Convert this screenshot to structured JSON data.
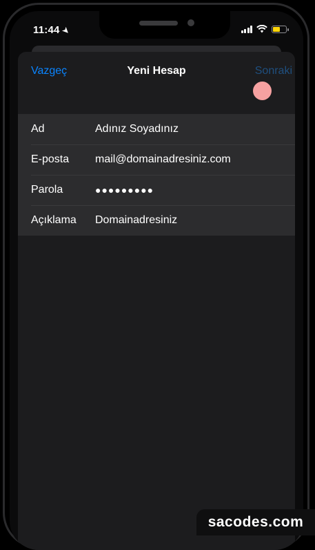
{
  "status_bar": {
    "time": "11:44",
    "location_icon": "location-arrow-icon",
    "signal_icon": "cellular-signal-icon",
    "wifi_icon": "wifi-icon",
    "battery_icon": "battery-icon",
    "battery_level": 0.55,
    "battery_color": "#ffd60a"
  },
  "nav": {
    "cancel_label": "Vazgeç",
    "title": "Yeni Hesap",
    "next_label": "Sonraki"
  },
  "colors": {
    "accent": "#0a84ff",
    "accent_disabled": "#1f4f7f",
    "touch_indicator": "#f6a1a1"
  },
  "form": {
    "rows": [
      {
        "label": "Ad",
        "value": "Adınız Soyadınız"
      },
      {
        "label": "E-posta",
        "value": "mail@domainadresiniz.com"
      },
      {
        "label": "Parola",
        "value": "●●●●●●●●●"
      },
      {
        "label": "Açıklama",
        "value": "Domainadresiniz"
      }
    ]
  },
  "watermark": {
    "text": "sacodes.com"
  }
}
